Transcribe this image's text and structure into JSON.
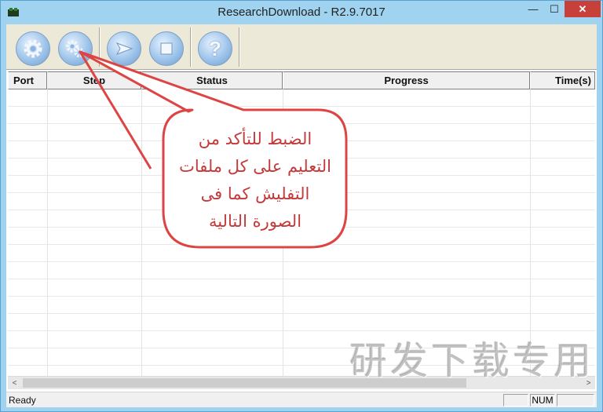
{
  "window": {
    "title": "ResearchDownload - R2.9.7017",
    "min_glyph": "—",
    "max_glyph": "☐",
    "close_glyph": "✕"
  },
  "toolbar": {
    "buttons": [
      {
        "name": "load-packet-button",
        "icon": "gear-icon"
      },
      {
        "name": "settings-button",
        "icon": "gears-icon"
      },
      {
        "name": "start-download-button",
        "icon": "play-arrow-icon"
      },
      {
        "name": "stop-download-button",
        "icon": "stop-icon"
      },
      {
        "name": "help-button",
        "icon": "question-icon",
        "glyph": "?"
      }
    ]
  },
  "list": {
    "columns": [
      "Port",
      "Step",
      "Status",
      "Progress",
      "Time(s)"
    ]
  },
  "scrollbar": {
    "left_glyph": "<",
    "right_glyph": ">"
  },
  "statusbar": {
    "status": "Ready",
    "num": "NUM"
  },
  "annotation": {
    "lines": [
      "الضبط للتأكد من",
      "التعليم على كل ملفات",
      "التفليش كما فى",
      "الصورة التالية"
    ],
    "color": "#c43a3a"
  },
  "watermark": "研发下载专用"
}
